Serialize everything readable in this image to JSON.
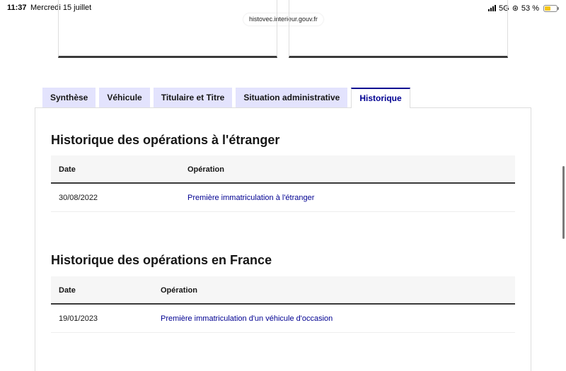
{
  "status_bar": {
    "time": "11:37",
    "date": "Mercredi 15 juillet",
    "network": "5G",
    "battery": "53 %",
    "battery_level": 0.53
  },
  "browser": {
    "url": "histovec.interieur.gouv.fr"
  },
  "tabs": [
    {
      "label": "Synthèse",
      "active": false
    },
    {
      "label": "Véhicule",
      "active": false
    },
    {
      "label": "Titulaire et Titre",
      "active": false
    },
    {
      "label": "Situation administrative",
      "active": false
    },
    {
      "label": "Historique",
      "active": true
    }
  ],
  "foreign_history": {
    "title": "Historique des opérations à l'étranger",
    "columns": [
      "Date",
      "Opération"
    ],
    "rows": [
      {
        "date": "30/08/2022",
        "operation": "Première immatriculation à l'étranger"
      }
    ]
  },
  "france_history": {
    "title": "Historique des opérations en France",
    "columns": [
      "Date",
      "Opération"
    ],
    "rows": [
      {
        "date": "19/01/2023",
        "operation": "Première immatriculation d'un véhicule d'occasion"
      }
    ]
  },
  "colors": {
    "accent": "#000091",
    "tab_bg": "#e3e3fd",
    "header_bg": "#f6f6f6"
  }
}
